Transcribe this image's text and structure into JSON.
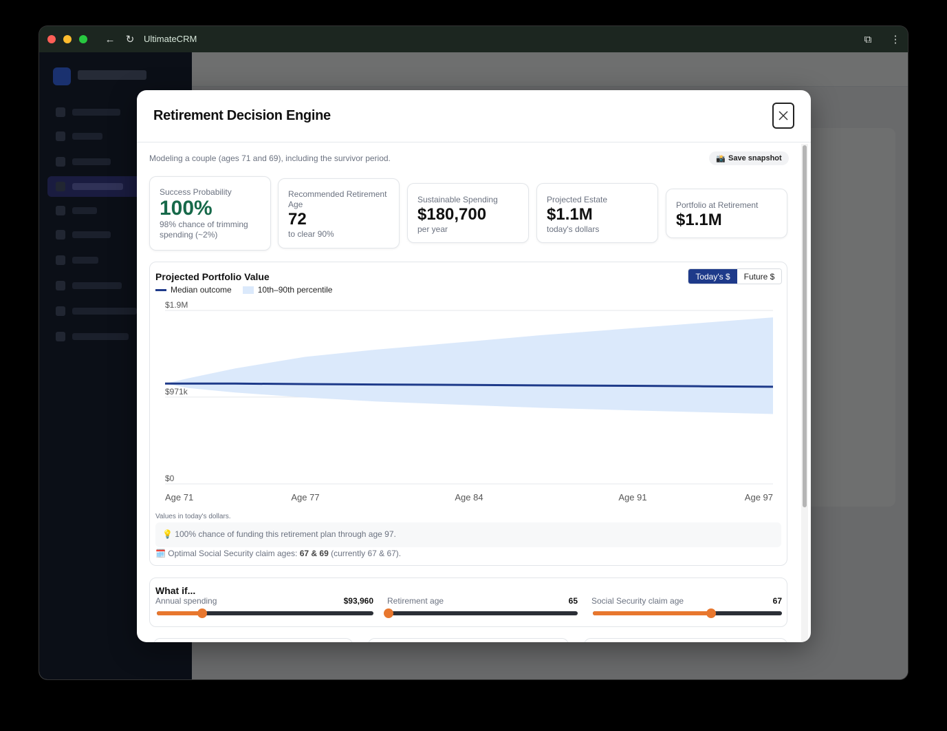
{
  "browser": {
    "title": "UltimateCRM"
  },
  "modal": {
    "title": "Retirement Decision Engine",
    "subtitle": "Modeling a couple (ages 71 and 69), including the survivor period.",
    "snapshot_label": "Save snapshot",
    "snapshot_icon": "📸"
  },
  "kpis": {
    "success": {
      "label": "Success Probability",
      "value": "100%",
      "sub": "98% chance of trimming spending (~2%)",
      "color": "#17694a"
    },
    "retire_age": {
      "label": "Recommended Retirement Age",
      "value": "72",
      "sub": "to clear 90%"
    },
    "spending": {
      "label": "Sustainable Spending",
      "value": "$180,700",
      "sub": "per year"
    },
    "estate": {
      "label": "Projected Estate",
      "value": "$1.1M",
      "sub": "today's dollars"
    },
    "portfolio": {
      "label": "Portfolio at Retirement",
      "value": "$1.1M"
    }
  },
  "chart": {
    "title": "Projected Portfolio Value",
    "toggle_today": "Today's $",
    "toggle_future": "Future $",
    "legend_median": "Median outcome",
    "legend_band": "10th–90th percentile",
    "note": "Values in today's dollars.",
    "callout_icon": "💡",
    "callout": "100% chance of funding this retirement plan through age 97.",
    "ss_icon": "🗓️",
    "ss_prefix": "Optimal Social Security claim ages:",
    "ss_value": "67 & 69",
    "ss_suffix": "(currently 67 & 67)."
  },
  "chart_data": {
    "type": "area",
    "title": "Projected Portfolio Value",
    "xlabel": "",
    "ylabel": "",
    "x_ticks": [
      "Age 71",
      "Age 77",
      "Age 84",
      "Age 91",
      "Age 97"
    ],
    "y_ticks": [
      "$0",
      "$971k",
      "$1.9M"
    ],
    "ylim": [
      0,
      1940000
    ],
    "xlim": [
      71,
      97
    ],
    "series": [
      {
        "name": "Median outcome",
        "x": [
          71,
          74,
          77,
          80,
          84,
          87,
          91,
          94,
          97
        ],
        "values": [
          1060000,
          1060000,
          1055000,
          1050000,
          1045000,
          1040000,
          1035000,
          1030000,
          1025000
        ]
      },
      {
        "name": "10th–90th percentile",
        "x": [
          71,
          72,
          74,
          77,
          80,
          84,
          87,
          91,
          94,
          97
        ],
        "low": [
          1060000,
          1010000,
          960000,
          905000,
          860000,
          820000,
          790000,
          760000,
          740000,
          720000
        ],
        "high": [
          1060000,
          1120000,
          1230000,
          1360000,
          1440000,
          1530000,
          1600000,
          1680000,
          1740000,
          1800000
        ]
      }
    ],
    "grid": true,
    "legend_position": "top-left"
  },
  "whatif": {
    "title": "What if...",
    "sliders": [
      {
        "label": "Annual spending",
        "value": "$93,960",
        "fraction": 0.21
      },
      {
        "label": "Retirement age",
        "value": "65",
        "fraction": 0.0
      },
      {
        "label": "Social Security claim age",
        "value": "67",
        "fraction": 0.625
      }
    ]
  }
}
